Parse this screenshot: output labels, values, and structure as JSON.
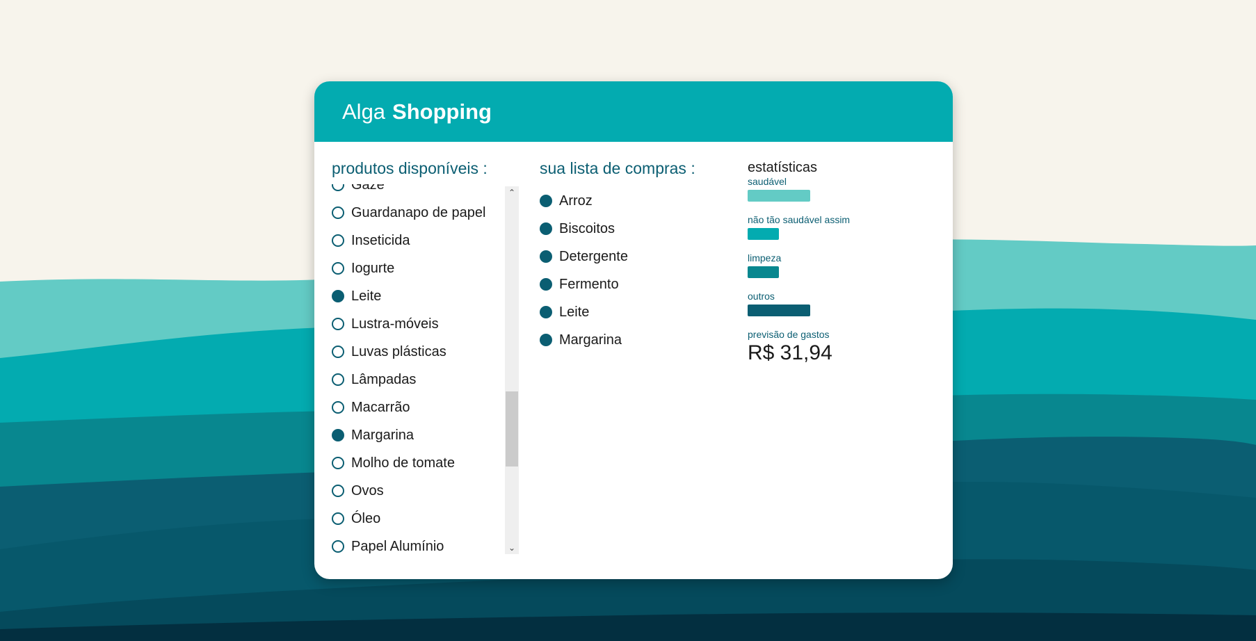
{
  "app": {
    "title_light": "Alga",
    "title_bold": "Shopping"
  },
  "available": {
    "title": "produtos disponíveis :",
    "items": [
      {
        "label": "Gaze",
        "selected": false
      },
      {
        "label": "Guardanapo de papel",
        "selected": false
      },
      {
        "label": "Inseticida",
        "selected": false
      },
      {
        "label": "Iogurte",
        "selected": false
      },
      {
        "label": "Leite",
        "selected": true
      },
      {
        "label": "Lustra-móveis",
        "selected": false
      },
      {
        "label": "Luvas plásticas",
        "selected": false
      },
      {
        "label": "Lâmpadas",
        "selected": false
      },
      {
        "label": "Macarrão",
        "selected": false
      },
      {
        "label": "Margarina",
        "selected": true
      },
      {
        "label": "Molho de tomate",
        "selected": false
      },
      {
        "label": "Ovos",
        "selected": false
      },
      {
        "label": "Óleo",
        "selected": false
      },
      {
        "label": "Papel Alumínio",
        "selected": false
      }
    ]
  },
  "cart": {
    "title": "sua lista de compras :",
    "items": [
      "Arroz",
      "Biscoitos",
      "Detergente",
      "Fermento",
      "Leite",
      "Margarina"
    ]
  },
  "stats": {
    "title": "estatísticas",
    "categories": [
      {
        "label": "saudável",
        "level": 2,
        "color": "#63cbc5"
      },
      {
        "label": "não tão saudável assim",
        "level": 1,
        "color": "#03abb0"
      },
      {
        "label": "limpeza",
        "level": 1,
        "color": "#08878f"
      },
      {
        "label": "outros",
        "level": 2,
        "color": "#0b5e72"
      }
    ],
    "forecast_label": "previsão de gastos",
    "forecast_value": "R$ 31,94"
  },
  "colors": {
    "accent": "#03abb0",
    "dark": "#0b5e72",
    "background": "#f7f4ec"
  }
}
